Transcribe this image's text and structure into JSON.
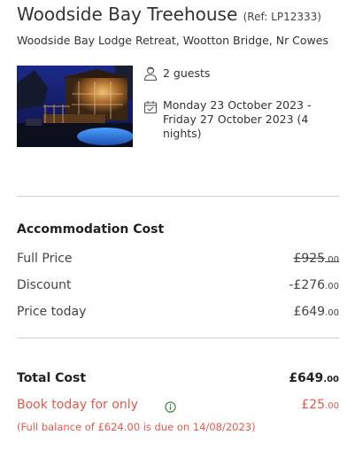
{
  "property": {
    "name": "Woodside Bay Treehouse",
    "ref": "(Ref: LP12333)",
    "address": "Woodside Bay Lodge Retreat, Wootton Bridge, Nr Cowes"
  },
  "booking": {
    "guests": "2 guests",
    "dates": "Monday 23 October 2023 - Friday 27 October 2023 (4 nights)"
  },
  "accommodation": {
    "title": "Accommodation Cost",
    "rows": [
      {
        "label": "Full Price",
        "main": "£925",
        "cents": ".00"
      },
      {
        "label": "Discount",
        "main": "-£276",
        "cents": ".00"
      },
      {
        "label": "Price today",
        "main": "£649",
        "cents": ".00"
      }
    ]
  },
  "total": {
    "label": "Total Cost",
    "main": "£649",
    "cents": ".00"
  },
  "deposit": {
    "label": "Book today for only",
    "main": "£25",
    "cents": ".00",
    "note": "(Full balance of £624.00 is due on 14/08/2023)"
  },
  "colors": {
    "accent_red": "#e8584c",
    "text": "#333333",
    "divider": "#cfcfcf"
  },
  "icons": {
    "guests": "person-icon",
    "dates": "calendar-check-icon",
    "info": "info-icon"
  }
}
